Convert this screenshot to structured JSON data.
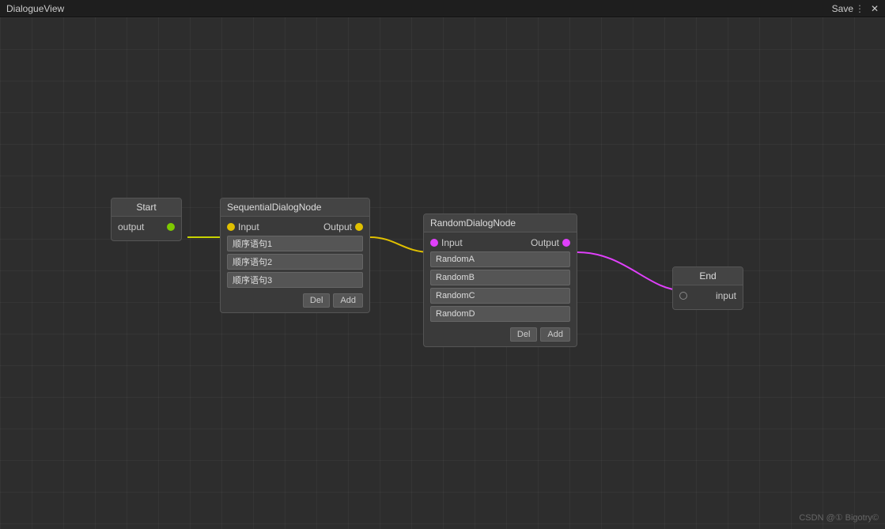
{
  "titlebar": {
    "title": "DialogueView",
    "menu_icon": "⋮",
    "close_icon": "✕",
    "save_label": "Save"
  },
  "nodes": {
    "start": {
      "header": "Start",
      "output_label": "output"
    },
    "sequential": {
      "header": "SequentialDialogNode",
      "input_label": "Input",
      "output_label": "Output",
      "fields": [
        "顺序语句1",
        "顺序语句2",
        "顺序语句3"
      ],
      "del_label": "Del",
      "add_label": "Add"
    },
    "random": {
      "header": "RandomDialogNode",
      "input_label": "Input",
      "output_label": "Output",
      "fields": [
        "RandomA",
        "RandomB",
        "RandomC",
        "RandomD"
      ],
      "del_label": "Del",
      "add_label": "Add"
    },
    "end": {
      "header": "End",
      "input_label": "input"
    }
  },
  "watermark": "CSDN @① Bigotry©"
}
